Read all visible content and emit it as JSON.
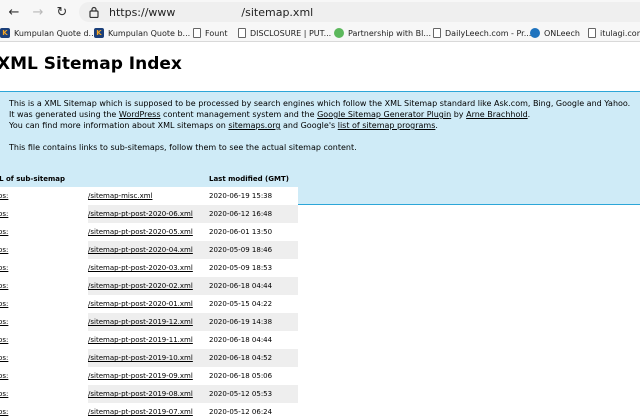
{
  "browser": {
    "url_scheme": "https://www",
    "url_path": "/sitemap.xml",
    "bookmarks": [
      {
        "label": "Kumpulan Quote d...",
        "icon": "kumpulan-icon"
      },
      {
        "label": "Kumpulan Quote b...",
        "icon": "kumpulan-icon"
      },
      {
        "label": "Fount",
        "icon": "page-icon"
      },
      {
        "label": "DISCLOSURE | PUT...",
        "icon": "page-icon"
      },
      {
        "label": "Partnership with Bl...",
        "icon": "partnership-icon"
      },
      {
        "label": "DailyLeech.com - Pr...",
        "icon": "page-icon"
      },
      {
        "label": "ONLeech",
        "icon": "onleech-icon"
      },
      {
        "label": "itulagi.com",
        "icon": "page-icon"
      }
    ]
  },
  "page": {
    "title": "XML Sitemap Index",
    "intro": {
      "line1": "This is a XML Sitemap which is supposed to be processed by search engines which follow the XML Sitemap standard like Ask.com, Bing, Google and Yahoo.",
      "line2_a": "It was generated using the ",
      "line2_link1": "WordPress",
      "line2_b": " content management system and the ",
      "line2_link2": "Google Sitemap Generator Plugin",
      "line2_c": " by ",
      "line2_link3": "Arne Brachhold",
      "line2_d": ".",
      "line3_a": "You can find more information about XML sitemaps on ",
      "line3_link1": "sitemaps.org",
      "line3_b": " and Google's ",
      "line3_link2": "list of sitemap programs",
      "line3_c": ".",
      "line4": "This file contains links to sub-sitemaps, follow them to see the actual sitemap content."
    },
    "table": {
      "col_url": "URL of sub-sitemap",
      "col_modified": "Last modified (GMT)",
      "rows": [
        {
          "prefix": "https:",
          "url": "/sitemap-misc.xml",
          "modified": "2020-06-19 15:38"
        },
        {
          "prefix": "https:",
          "url": "/sitemap-pt-post-2020-06.xml",
          "modified": "2020-06-12 16:48"
        },
        {
          "prefix": "https:",
          "url": "/sitemap-pt-post-2020-05.xml",
          "modified": "2020-06-01 13:50"
        },
        {
          "prefix": "https:",
          "url": "/sitemap-pt-post-2020-04.xml",
          "modified": "2020-05-09 18:46"
        },
        {
          "prefix": "https:",
          "url": "/sitemap-pt-post-2020-03.xml",
          "modified": "2020-05-09 18:53"
        },
        {
          "prefix": "https:",
          "url": "/sitemap-pt-post-2020-02.xml",
          "modified": "2020-06-18 04:44"
        },
        {
          "prefix": "https:",
          "url": "/sitemap-pt-post-2020-01.xml",
          "modified": "2020-05-15 04:22"
        },
        {
          "prefix": "https:",
          "url": "/sitemap-pt-post-2019-12.xml",
          "modified": "2020-06-19 14:38"
        },
        {
          "prefix": "https:",
          "url": "/sitemap-pt-post-2019-11.xml",
          "modified": "2020-06-18 04:44"
        },
        {
          "prefix": "https:",
          "url": "/sitemap-pt-post-2019-10.xml",
          "modified": "2020-06-18 04:52"
        },
        {
          "prefix": "https:",
          "url": "/sitemap-pt-post-2019-09.xml",
          "modified": "2020-06-18 05:06"
        },
        {
          "prefix": "https:",
          "url": "/sitemap-pt-post-2019-08.xml",
          "modified": "2020-05-12 05:53"
        },
        {
          "prefix": "https:",
          "url": "/sitemap-pt-post-2019-07.xml",
          "modified": "2020-05-12 06:24"
        }
      ]
    }
  }
}
